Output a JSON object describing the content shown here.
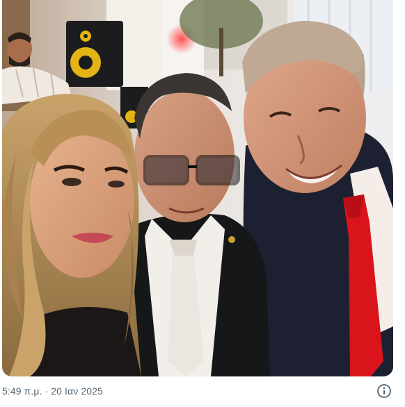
{
  "post": {
    "timestamp": "5:49 π.μ. · 20 Ιαν 2025",
    "media_alt": "",
    "info_icon": "info-circle-icon"
  },
  "colors": {
    "meta_text": "#536471",
    "icon": "#536471",
    "divider": "#eff3f4"
  }
}
